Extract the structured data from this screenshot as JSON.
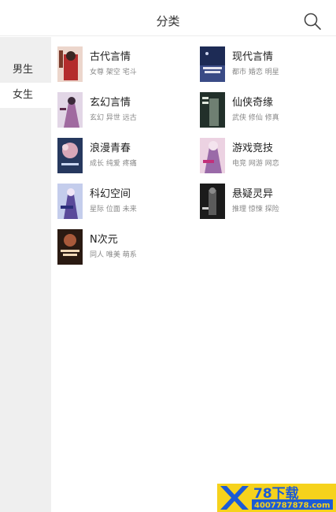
{
  "header": {
    "title": "分类",
    "search_icon": "search-icon"
  },
  "sidebar": {
    "items": [
      {
        "label": "男生"
      },
      {
        "label": "女生",
        "selected": true
      }
    ]
  },
  "categories": [
    {
      "name": "古代言情",
      "tags": "女尊 架空 宅斗",
      "cover_colors": [
        "#e9d2c8",
        "#b42c2c"
      ]
    },
    {
      "name": "现代言情",
      "tags": "都市 婚恋 明星",
      "cover_colors": [
        "#1d2b55",
        "#3a4b86"
      ]
    },
    {
      "name": "玄幻言情",
      "tags": "玄幻 异世 远古",
      "cover_colors": [
        "#d9cde0",
        "#a06aa0"
      ]
    },
    {
      "name": "仙侠奇缘",
      "tags": "武侠 修仙 修真",
      "cover_colors": [
        "#22302a",
        "#6f7f72"
      ]
    },
    {
      "name": "浪漫青春",
      "tags": "成长 纯爱 疼痛",
      "cover_colors": [
        "#26385e",
        "#d8a7b8"
      ]
    },
    {
      "name": "游戏竞技",
      "tags": "电竞 网游 网恋",
      "cover_colors": [
        "#e7c8dc",
        "#9a6aa8"
      ]
    },
    {
      "name": "科幻空间",
      "tags": "星际 位面 未来",
      "cover_colors": [
        "#bcc6e8",
        "#5a4a9a"
      ]
    },
    {
      "name": "悬疑灵异",
      "tags": "推理 惊悚 探险",
      "cover_colors": [
        "#1b1b1b",
        "#5b5b5b"
      ]
    },
    {
      "name": "N次元",
      "tags": "同人 唯美 萌系",
      "cover_colors": [
        "#2a1a12",
        "#a8593a"
      ]
    }
  ],
  "watermark": {
    "text": "78下载",
    "url": "4007787878.com",
    "colors": {
      "yellow": "#f6d21c",
      "blue": "#1c5bd6"
    }
  }
}
